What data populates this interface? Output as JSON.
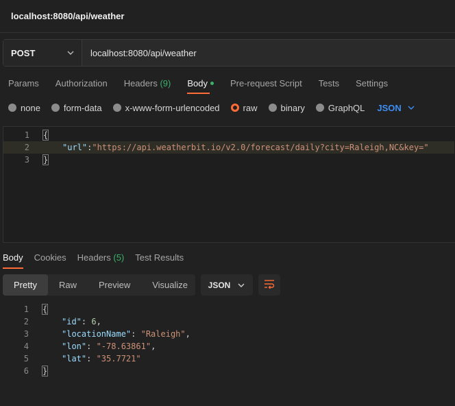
{
  "window": {
    "title": "localhost:8080/api/weather"
  },
  "request": {
    "method": "POST",
    "url": "localhost:8080/api/weather",
    "tabs": [
      {
        "label": "Params"
      },
      {
        "label": "Authorization"
      },
      {
        "label": "Headers",
        "count": "(9)"
      },
      {
        "label": "Body"
      },
      {
        "label": "Pre-request Script"
      },
      {
        "label": "Tests"
      },
      {
        "label": "Settings"
      }
    ],
    "body_options": [
      "none",
      "form-data",
      "x-www-form-urlencoded",
      "raw",
      "binary",
      "GraphQL"
    ],
    "selected_body_option": "raw",
    "format": "JSON",
    "editor_lines": {
      "l1": "1",
      "l2": "2",
      "l3": "3",
      "open": "{",
      "key": "\"url\"",
      "colon": ":",
      "value": "\"https://api.weatherbit.io/v2.0/forecast/daily?city=Raleigh,NC&key=\"",
      "close": "}"
    }
  },
  "response": {
    "tabs": [
      {
        "label": "Body"
      },
      {
        "label": "Cookies"
      },
      {
        "label": "Headers",
        "count": "(5)"
      },
      {
        "label": "Test Results"
      }
    ],
    "view_modes": [
      "Pretty",
      "Raw",
      "Preview",
      "Visualize"
    ],
    "format": "JSON",
    "lines": {
      "n1": "1",
      "n2": "2",
      "n3": "3",
      "n4": "4",
      "n5": "5",
      "n6": "6",
      "open": "{",
      "k_id": "\"id\"",
      "v_id": "6",
      "k_loc": "\"locationName\"",
      "v_loc": "\"Raleigh\"",
      "k_lon": "\"lon\"",
      "v_lon": "\"-78.63861\"",
      "k_lat": "\"lat\"",
      "v_lat": "\"35.7721\"",
      "close": "}"
    }
  },
  "colors": {
    "accent": "#ff6c37",
    "green": "#3bb26a",
    "blue": "#3d8ef5"
  }
}
